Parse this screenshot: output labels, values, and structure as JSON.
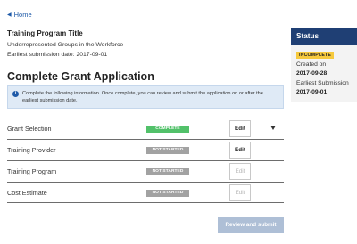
{
  "nav": {
    "home_label": "Home"
  },
  "program": {
    "title": "Training Program Title",
    "subtitle": "Underrepresented Groups in the Workforce",
    "earliest_submission": "Earliest submission date: 2017-09-01"
  },
  "page": {
    "title": "Complete Grant Application"
  },
  "info": {
    "text": "Complete the following information. Once complete, you can review and submit the application on or after the earliest submission date."
  },
  "tasks": [
    {
      "name": "Grant Selection",
      "status": "COMPLETE",
      "edit_label": "Edit",
      "edit_enabled": true
    },
    {
      "name": "Training Provider",
      "status": "NOT STARTED",
      "edit_label": "Edit",
      "edit_enabled": true
    },
    {
      "name": "Training Program",
      "status": "NOT STARTED",
      "edit_label": "Edit",
      "edit_enabled": false
    },
    {
      "name": "Cost Estimate",
      "status": "NOT STARTED",
      "edit_label": "Edit",
      "edit_enabled": false
    }
  ],
  "actions": {
    "review_label": "Review and submit"
  },
  "status_panel": {
    "title": "Status",
    "badge": "INCOMPLETE",
    "created_label": "Created on",
    "created_value": "2017-09-28",
    "earliest_label": "Earliest Submission",
    "earliest_value": "2017-09-01"
  },
  "colors": {
    "link": "#1e5aa8",
    "complete": "#52c16a",
    "not_started": "#a2a2a2",
    "status_header": "#1f3f74",
    "incomplete_badge": "#f6c93d",
    "review_button": "#aebfd6"
  },
  "icons": {
    "home": "caret-left-icon",
    "info": "info-icon",
    "expand": "chevron-down-icon"
  }
}
